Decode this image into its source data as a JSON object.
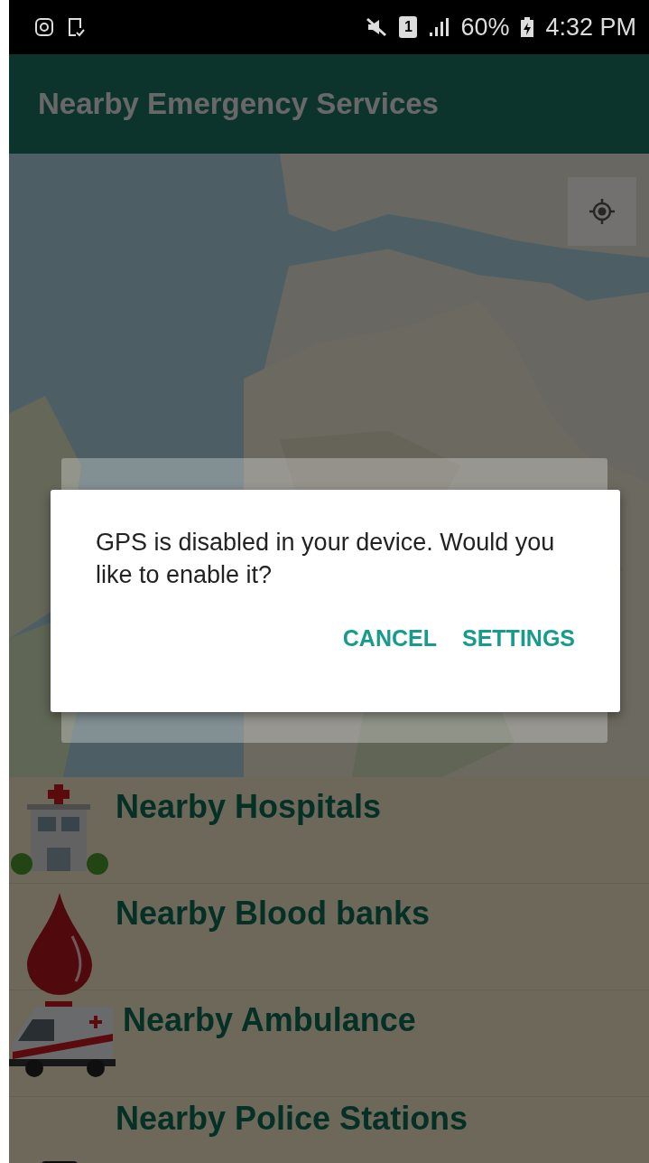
{
  "status_bar": {
    "sim_slot": "1",
    "battery": "60%",
    "time": "4:32 PM"
  },
  "app_bar": {
    "title": "Nearby Emergency Services"
  },
  "dialog": {
    "message": "GPS is disabled in your device. Would you like to enable it?",
    "buttons": [
      "CANCEL",
      "SETTINGS"
    ]
  },
  "services": [
    {
      "kind": "hospital",
      "label": "Nearby Hospitals"
    },
    {
      "kind": "blood",
      "label": "Nearby Blood banks"
    },
    {
      "kind": "ambulance",
      "label": "Nearby Ambulance"
    },
    {
      "kind": "police",
      "label": "Nearby Police Stations"
    }
  ]
}
